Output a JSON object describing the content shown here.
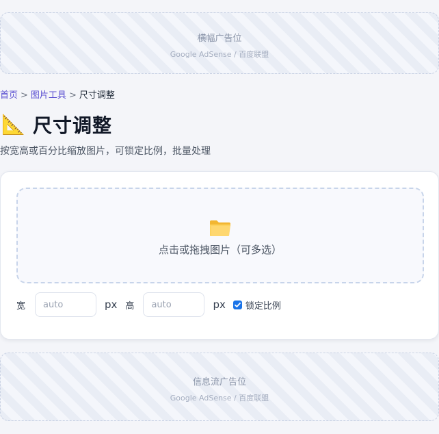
{
  "ads": {
    "top": {
      "title": "横幅广告位",
      "sub": "Google AdSense / 百度联盟"
    },
    "bottom": {
      "title": "信息流广告位",
      "sub": "Google AdSense / 百度联盟"
    }
  },
  "breadcrumb": {
    "home": "首页",
    "tools": "图片工具",
    "current": "尺寸调整",
    "separator": ">"
  },
  "header": {
    "icon": "📐",
    "icon_name": "triangular-ruler-icon",
    "title": "尺寸调整",
    "subtitle": "按宽高或百分比缩放图片，可锁定比例，批量处理"
  },
  "uploader": {
    "icon_name": "folder-icon",
    "prompt": "点击或拖拽图片（可多选）"
  },
  "controls": {
    "width_label": "宽",
    "width_placeholder": "auto",
    "width_unit": "px",
    "height_label": "高",
    "height_placeholder": "auto",
    "height_unit": "px",
    "lock_label": "锁定比例",
    "lock_checked": true
  },
  "colors": {
    "accent": "#5a4fd1",
    "checkbox": "#1a73e8",
    "page_bg": "#f4f5f9"
  }
}
